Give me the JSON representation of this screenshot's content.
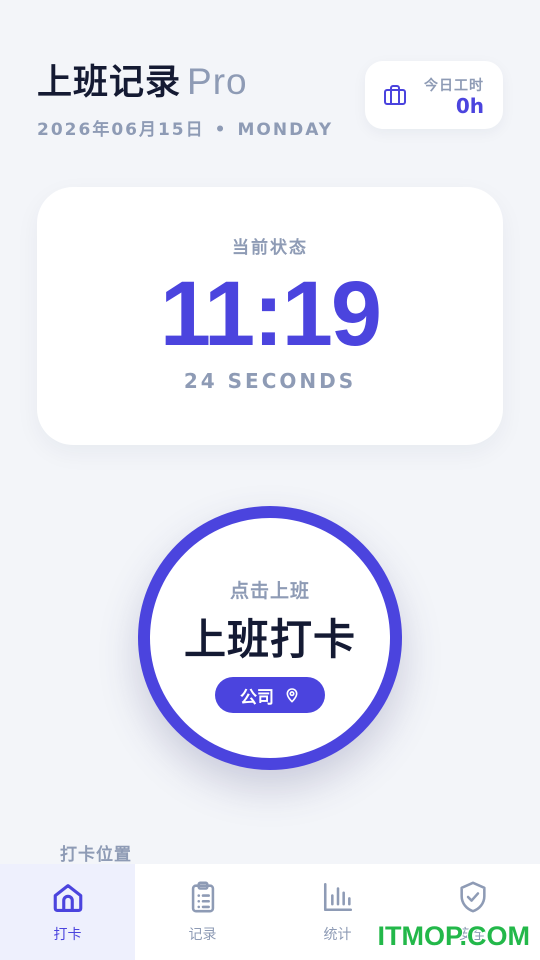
{
  "header": {
    "title": "上班记录",
    "title_suffix": "Pro",
    "date": "2026年06月15日",
    "separator": "•",
    "weekday": "MONDAY"
  },
  "today": {
    "icon": "briefcase-icon",
    "label": "今日工时",
    "value": "0h"
  },
  "status": {
    "label": "当前状态",
    "time": "11:19",
    "seconds": "24 SECONDS"
  },
  "punch": {
    "hint": "点击上班",
    "label": "上班打卡",
    "location": "公司",
    "location_icon": "map-pin-icon"
  },
  "section": {
    "label": "打卡位置"
  },
  "tabs": [
    {
      "label": "打卡",
      "icon": "home-icon",
      "active": true
    },
    {
      "label": "记录",
      "icon": "clipboard-list-icon",
      "active": false
    },
    {
      "label": "统计",
      "icon": "bar-chart-icon",
      "active": false
    },
    {
      "label": "安全",
      "icon": "shield-check-icon",
      "active": false
    }
  ],
  "watermark": "ITMOP.COM",
  "colors": {
    "accent": "#4b44de",
    "muted": "#8e9bb5",
    "text": "#141a33",
    "background": "#f3f5f9"
  }
}
